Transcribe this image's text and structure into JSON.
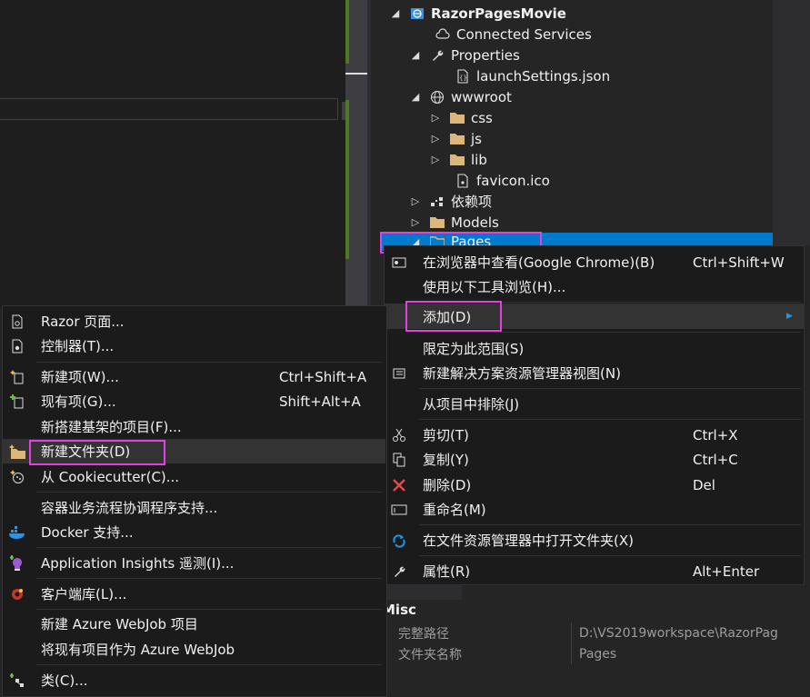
{
  "solution_explorer": {
    "project": "RazorPagesMovie",
    "items": [
      {
        "label": "Connected Services",
        "icon": "connected-services-icon"
      },
      {
        "label": "Properties",
        "icon": "wrench-icon"
      },
      {
        "label": "launchSettings.json",
        "icon": "json-file-icon"
      },
      {
        "label": "wwwroot",
        "icon": "globe-icon"
      },
      {
        "label": "css",
        "icon": "folder-icon"
      },
      {
        "label": "js",
        "icon": "folder-icon"
      },
      {
        "label": "lib",
        "icon": "folder-icon"
      },
      {
        "label": "favicon.ico",
        "icon": "ico-file-icon"
      },
      {
        "label": "依赖项",
        "icon": "dependencies-icon"
      },
      {
        "label": "Models",
        "icon": "folder-icon"
      },
      {
        "label": "Pages",
        "icon": "folder-icon",
        "selected": true
      }
    ]
  },
  "context_menu": {
    "items": [
      {
        "label": "在浏览器中查看(Google Chrome)(B)",
        "shortcut": "Ctrl+Shift+W",
        "icon": "browser-view-icon"
      },
      {
        "label": "使用以下工具浏览(H)...",
        "shortcut": ""
      },
      {
        "label": "添加(D)",
        "submenu": true,
        "highlighted": true
      },
      {
        "label": "限定为此范围(S)"
      },
      {
        "label": "新建解决方案资源管理器视图(N)",
        "icon": "new-view-icon"
      },
      {
        "label": "从项目中排除(J)"
      },
      {
        "label": "剪切(T)",
        "shortcut": "Ctrl+X",
        "icon": "cut-icon"
      },
      {
        "label": "复制(Y)",
        "shortcut": "Ctrl+C",
        "icon": "copy-icon"
      },
      {
        "label": "删除(D)",
        "shortcut": "Del",
        "icon": "delete-icon"
      },
      {
        "label": "重命名(M)",
        "icon": "rename-icon"
      },
      {
        "label": "在文件资源管理器中打开文件夹(X)",
        "icon": "refresh-open-icon"
      },
      {
        "label": "属性(R)",
        "shortcut": "Alt+Enter",
        "icon": "wrench-icon"
      }
    ]
  },
  "add_submenu": {
    "items": [
      {
        "label": "Razor 页面...",
        "icon": "razor-page-icon"
      },
      {
        "label": "控制器(T)...",
        "icon": "controller-icon"
      },
      {
        "label": "新建项(W)...",
        "shortcut": "Ctrl+Shift+A",
        "icon": "new-item-icon"
      },
      {
        "label": "现有项(G)...",
        "shortcut": "Shift+Alt+A",
        "icon": "existing-item-icon"
      },
      {
        "label": "新搭建基架的项目(F)..."
      },
      {
        "label": "新建文件夹(D)",
        "icon": "new-folder-icon",
        "highlighted": true
      },
      {
        "label": "从 Cookiecutter(C)...",
        "icon": "cookiecutter-icon"
      },
      {
        "label": "容器业务流程协调程序支持..."
      },
      {
        "label": "Docker 支持...",
        "icon": "docker-icon"
      },
      {
        "label": "Application Insights 遥测(I)...",
        "icon": "app-insights-icon"
      },
      {
        "label": "客户端库(L)...",
        "icon": "client-library-icon"
      },
      {
        "label": "新建 Azure WebJob 项目"
      },
      {
        "label": "将现有项目作为 Azure WebJob"
      },
      {
        "label": "类(C)...",
        "icon": "class-icon"
      }
    ]
  },
  "properties": {
    "category": "Misc",
    "rows": [
      {
        "key": "完整路径",
        "value": "D:\\VS2019workspace\\RazorPag"
      },
      {
        "key": "文件夹名称",
        "value": "Pages"
      }
    ]
  },
  "colors": {
    "accent": "#007acc",
    "annotation_outline": "#e041e0",
    "menu_bg": "#1b1b1c",
    "folder": "#dcb67a"
  }
}
